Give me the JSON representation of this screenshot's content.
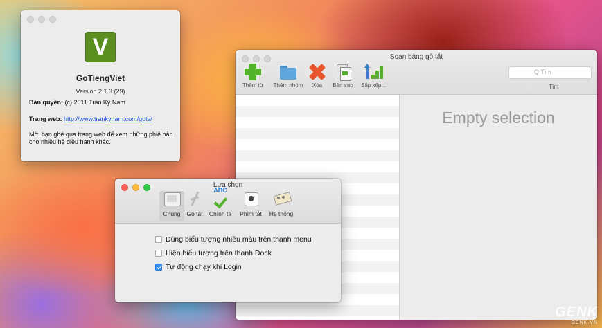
{
  "about": {
    "logo_letter": "V",
    "app_name": "GoTiengViet",
    "version": "Version 2.1.3 (29)",
    "copyright_label": "Bản quyền:",
    "copyright_value": "(c) 2011 Trần Kỳ Nam",
    "website_label": "Trang web:",
    "website_url": "http://www.trankynam.com/gotv/",
    "note": "Mời bạn ghé qua trang web để xem những phiê bản cho nhiều hệ điều hành khác."
  },
  "editor": {
    "title": "Soạn bảng gõ tắt",
    "toolbar": [
      {
        "label": "Thêm từ",
        "icon": "plus-icon"
      },
      {
        "label": "Thêm nhóm",
        "icon": "folder-icon"
      },
      {
        "label": "Xóa",
        "icon": "delete-x-icon"
      },
      {
        "label": "Bản sao",
        "icon": "copy-icon"
      },
      {
        "label": "Sắp xếp...",
        "icon": "sort-icon"
      }
    ],
    "search_placeholder": "Q Tìm",
    "search_label": "Tìm",
    "empty_text": "Empty selection"
  },
  "prefs": {
    "title": "Lựa chọn",
    "tabs": [
      {
        "label": "Chung",
        "icon": "general-icon",
        "selected": true
      },
      {
        "label": "Gõ tắt",
        "icon": "shortcut-icon",
        "selected": false
      },
      {
        "label": "Chính tả",
        "icon": "spelling-icon",
        "selected": false
      },
      {
        "label": "Phím tắt",
        "icon": "hotkey-icon",
        "selected": false
      },
      {
        "label": "Hệ thống",
        "icon": "system-icon",
        "selected": false
      }
    ],
    "options": [
      {
        "label": "Dùng biểu tượng nhiều màu trên thanh menu",
        "checked": false
      },
      {
        "label": "Hiện biểu tượng trên thanh Dock",
        "checked": false
      },
      {
        "label": "Tự động chạy khi Login",
        "checked": true
      }
    ]
  },
  "watermark": {
    "big": "GENK",
    "small": "GENK.VN"
  }
}
